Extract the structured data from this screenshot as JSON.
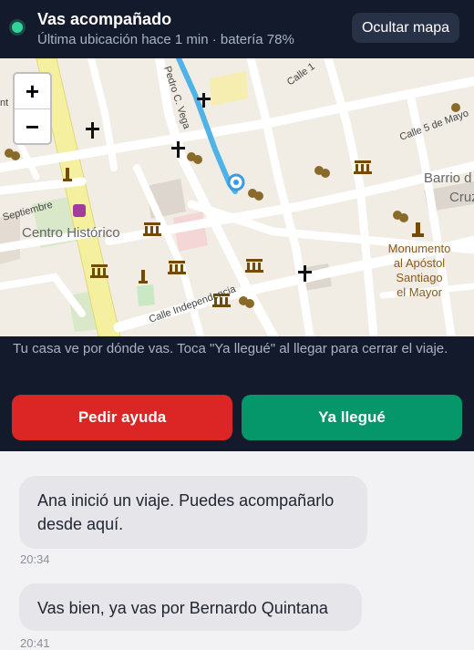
{
  "header": {
    "title": "Vas acompañado",
    "subtitle": "Última ubicación hace 1 min · batería 78%",
    "hide_map_label": "Ocultar mapa"
  },
  "map": {
    "zoom_in": "+",
    "zoom_out": "−",
    "labels": {
      "centro_historico": "Centro Histórico",
      "barrio_line1": "Barrio d",
      "barrio_line2": "Cruz",
      "monumento_1": "Monumento",
      "monumento_2": "al Apóstol",
      "monumento_3": "Santiago",
      "monumento_4": "el Mayor",
      "calle_independencia": "Calle Independencia",
      "calle_5_mayo": "Calle 5 de Mayo",
      "septiembre": "Septiembre",
      "calle_top": "Calle 1",
      "pedro_vega": "Pedro C. Vega",
      "nt": "nt"
    }
  },
  "info": {
    "text": "Tu casa ve por dónde vas. Toca \"Ya llegué\" al llegar para cerrar el viaje."
  },
  "actions": {
    "help_label": "Pedir ayuda",
    "arrived_label": "Ya llegué"
  },
  "messages": [
    {
      "text": "Ana inició un viaje. Puedes acompañarlo desde aquí.",
      "time": "20:34"
    },
    {
      "text": "Vas bien, ya vas por Bernardo Quintana",
      "time": "20:41"
    }
  ],
  "colors": {
    "header_bg": "#121a2b",
    "status_green": "#34d399",
    "help_red": "#dc2626",
    "arrived_green": "#059669",
    "route_blue": "#4fb3e8"
  }
}
